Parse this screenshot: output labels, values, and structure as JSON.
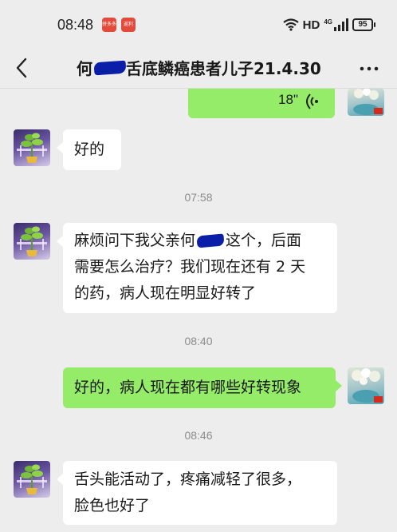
{
  "status_bar": {
    "time": "08:48",
    "app_badges": [
      "拼多多",
      "返利"
    ],
    "network": "HD",
    "signal_type": "4G",
    "battery": "95"
  },
  "header": {
    "title_prefix": "何",
    "title_suffix": "舌底鳞癌患者儿子21.4.30"
  },
  "messages": {
    "voice": {
      "duration": "18\""
    },
    "msg1": {
      "text": "好的"
    },
    "ts1": "07:58",
    "msg2": {
      "line1_pre": "麻烦问下我父亲何",
      "line1_post": "这个，后面",
      "line2": "需要怎么治疗？我们现在还有 2 天",
      "line3": "的药，病人现在明显好转了"
    },
    "ts2": "08:40",
    "msg3": {
      "text": "好的，病人现在都有哪些好转现象"
    },
    "ts3": "08:46",
    "msg4": {
      "line1": "舌头能活动了，疼痛减轻了很多，",
      "line2": "脸色也好了"
    }
  },
  "colors": {
    "background": "#ededed",
    "outgoing_bubble": "#95ec69",
    "incoming_bubble": "#ffffff",
    "redaction": "#0a1ea8"
  }
}
